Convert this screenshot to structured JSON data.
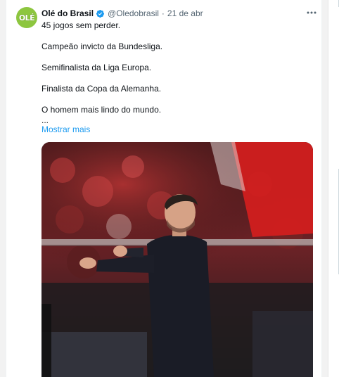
{
  "tweet": {
    "display_name": "Olé do Brasil",
    "handle": "@Oledobrasil",
    "separator": "·",
    "date": "21 de abr",
    "avatar_text": "OLÉ",
    "lines": [
      "45 jogos sem perder.",
      "",
      "Campeão invicto da Bundesliga.",
      "",
      "Semifinalista da Liga Europa.",
      "",
      "Finalista da Copa da Alemanha.",
      "",
      "O homem mais lindo do mundo.",
      "..."
    ],
    "show_more_label": "Mostrar mais",
    "verified": true
  },
  "icons": {
    "verified": "verified-badge-icon",
    "more": "more-horizontal-icon"
  },
  "colors": {
    "accent": "#1d9bf0",
    "text": "#0f1419",
    "muted": "#536471",
    "avatar_bg": "#8dc63f"
  }
}
